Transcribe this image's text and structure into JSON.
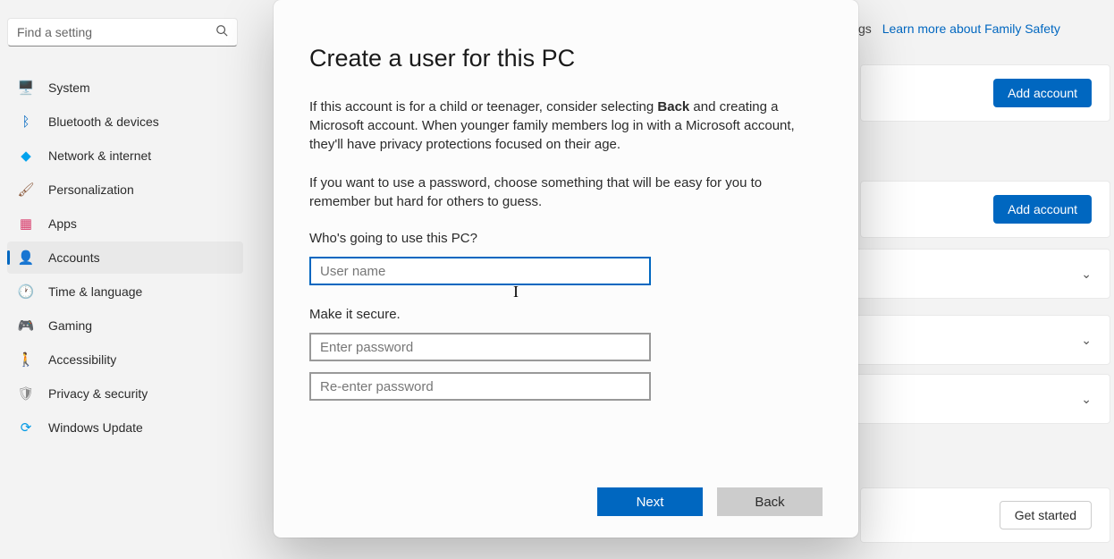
{
  "search": {
    "placeholder": "Find a setting"
  },
  "sidebar": {
    "items": [
      {
        "label": "System",
        "icon": "🖥️",
        "color": "#0067c0"
      },
      {
        "label": "Bluetooth & devices",
        "icon": "ᛒ",
        "color": "#0067c0"
      },
      {
        "label": "Network & internet",
        "icon": "◆",
        "color": "#00a2ed"
      },
      {
        "label": "Personalization",
        "icon": "🖌",
        "color": "#8b5a3c"
      },
      {
        "label": "Apps",
        "icon": "▦",
        "color": "#d83b6b"
      },
      {
        "label": "Accounts",
        "icon": "👤",
        "color": "#0067c0",
        "active": true
      },
      {
        "label": "Time & language",
        "icon": "🕐",
        "color": "#555"
      },
      {
        "label": "Gaming",
        "icon": "🎮",
        "color": "#777"
      },
      {
        "label": "Accessibility",
        "icon": "🚶",
        "color": "#0067c0"
      },
      {
        "label": "Privacy & security",
        "icon": "🛡",
        "color": "#888"
      },
      {
        "label": "Windows Update",
        "icon": "⟳",
        "color": "#0099e5"
      }
    ]
  },
  "bg": {
    "gs_prefix": "gs",
    "family_link": "Learn more about Family Safety",
    "add_account1": "Add account",
    "add_account2": "Add account",
    "get_started": "Get started"
  },
  "modal": {
    "title": "Create a user for this PC",
    "para1_a": "If this account is for a child or teenager, consider selecting ",
    "para1_bold": "Back",
    "para1_b": " and creating a Microsoft account. When younger family members log in with a Microsoft account, they'll have privacy protections focused on their age.",
    "para2": "If you want to use a password, choose something that will be easy for you to remember but hard for others to guess.",
    "who_label": "Who's going to use this PC?",
    "username_placeholder": "User name",
    "secure_label": "Make it secure.",
    "pw_placeholder": "Enter password",
    "pw2_placeholder": "Re-enter password",
    "next": "Next",
    "back": "Back"
  }
}
